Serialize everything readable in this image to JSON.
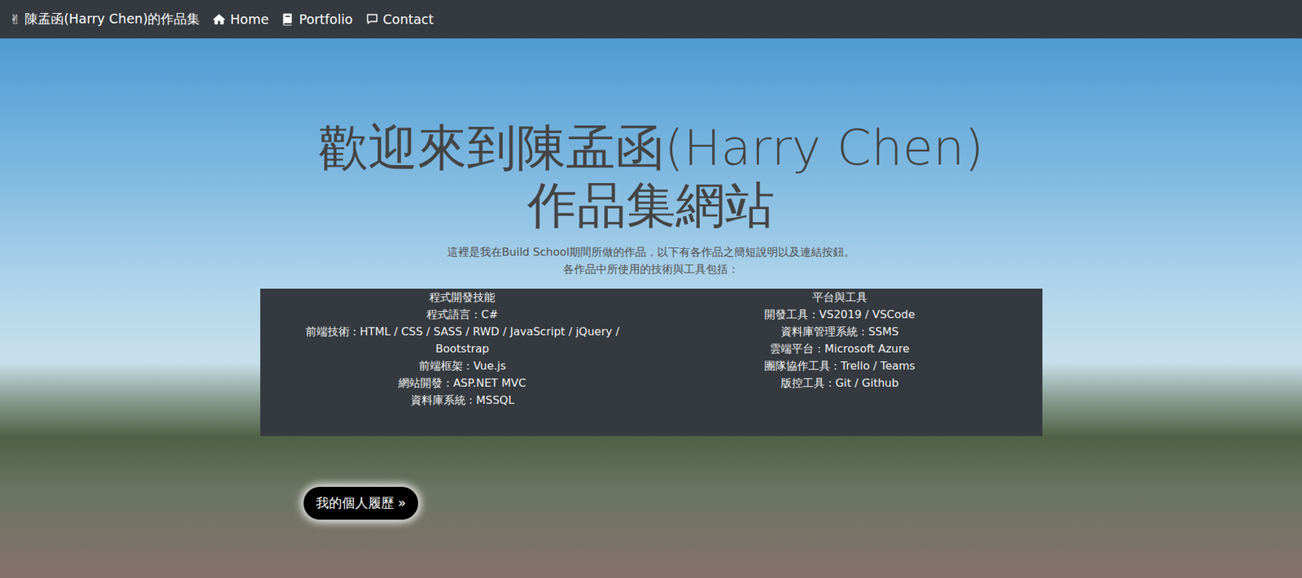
{
  "navbar": {
    "brand_icon": "✌",
    "brand": "陳孟函(Harry Chen)的作品集",
    "links": [
      {
        "label": "Home"
      },
      {
        "label": "Portfolio"
      },
      {
        "label": "Contact"
      }
    ]
  },
  "hero": {
    "title": [
      "歡迎來到陳孟函(Harry Chen)",
      "作品集網站"
    ],
    "intro": [
      "這裡是我在Build School期間所做的作品，以下有各作品之簡短說明以及連結按鈕。",
      "各作品中所使用的技術與工具包括："
    ],
    "columns": [
      {
        "heading": "程式開發技能",
        "items": [
          "程式語言 : C#",
          "前端技術 : HTML / CSS / SASS / RWD / JavaScript / jQuery / Bootstrap",
          "前端框架 : Vue.js",
          "網站開發 : ASP.NET MVC",
          "資料庫系統 : MSSQL"
        ]
      },
      {
        "heading": "平台與工具",
        "items": [
          "開發工具 : VS2019 / VSCode",
          "資料庫管理系統 : SSMS",
          "雲端平台 : Microsoft Azure",
          "團隊協作工具 : Trello / Teams",
          "版控工具 : Git / Github"
        ]
      }
    ],
    "button": "我的個人履歷 »"
  }
}
